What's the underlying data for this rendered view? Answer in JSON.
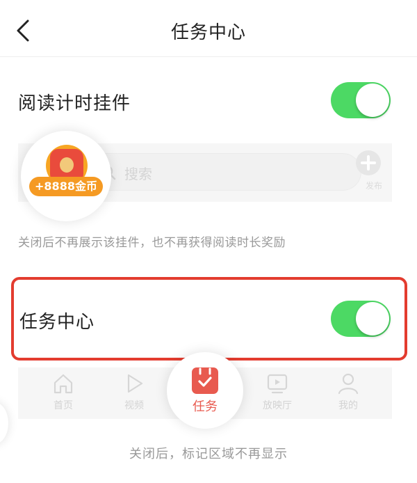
{
  "header": {
    "title": "任务中心"
  },
  "reading_widget": {
    "label": "阅读计时挂件",
    "toggle_on": true,
    "preview": {
      "coin_text": "+8888金币",
      "search_placeholder": "搜索",
      "plus_label": "发布"
    },
    "description": "关闭后不再展示该挂件，也不再获得阅读时长奖励"
  },
  "task_center": {
    "label": "任务中心",
    "toggle_on": true,
    "highlight_color": "#e33c2f"
  },
  "tabbar_preview": {
    "tabs": [
      {
        "label": "首页",
        "icon": "home-icon"
      },
      {
        "label": "视频",
        "icon": "play-icon"
      },
      {
        "label": "任务",
        "icon": "calendar-check-icon"
      },
      {
        "label": "放映厅",
        "icon": "tv-icon"
      },
      {
        "label": "我的",
        "icon": "user-icon"
      }
    ]
  },
  "bottom_note": "关闭后，标记区域不再显示",
  "colors": {
    "toggle_on": "#4cd964",
    "accent_red": "#e85a4f",
    "coin_orange": "#f59a23"
  }
}
